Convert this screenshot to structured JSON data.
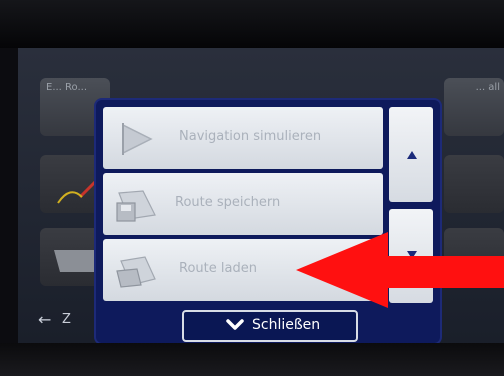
{
  "background_tiles": {
    "t1_text": "E... Ro...",
    "t4_text": "... all"
  },
  "bottom_bar": {
    "back_label": "Z"
  },
  "menu": {
    "items": [
      {
        "label": "Navigation simulieren",
        "icon": "flag-play-icon"
      },
      {
        "label": "Route speichern",
        "icon": "save-route-icon"
      },
      {
        "label": "Route laden",
        "icon": "load-route-icon"
      }
    ],
    "close_label": "Schließen"
  },
  "colors": {
    "popup_bg": "#0e1a5c",
    "item_bg": "#e4e8ee",
    "item_text_disabled": "#aab1bb",
    "annotation_arrow": "#ff1010"
  }
}
